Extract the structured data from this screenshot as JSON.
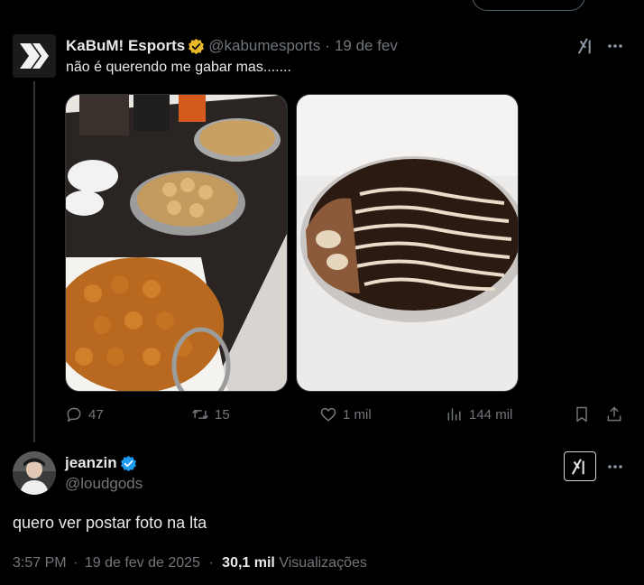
{
  "tweet": {
    "display_name": "KaBuM! Esports",
    "handle": "@kabumesports",
    "separator": "·",
    "date": "19 de fev",
    "text": "não é querendo me gabar mas.......",
    "actions": {
      "replies": "47",
      "retweets": "15",
      "likes": "1 mil",
      "views": "144 mil"
    }
  },
  "reply": {
    "display_name": "jeanzin",
    "handle": "@loudgods",
    "text": "quero ver postar foto na lta",
    "time": "3:57 PM",
    "separator": "·",
    "date": "19 de fev de 2025",
    "separator2": "·",
    "views_count": "30,1 mil",
    "views_label": "Visualizações"
  },
  "colors": {
    "background": "#000000",
    "text_primary": "#e7e9ea",
    "text_secondary": "#71767b",
    "verified_gold": "#e8b829",
    "verified_blue": "#1d9bf0"
  },
  "icons": [
    "reply-icon",
    "retweet-icon",
    "like-icon",
    "views-icon",
    "bookmark-icon",
    "share-icon",
    "grok-icon",
    "more-icon",
    "verified-badge-icon"
  ]
}
